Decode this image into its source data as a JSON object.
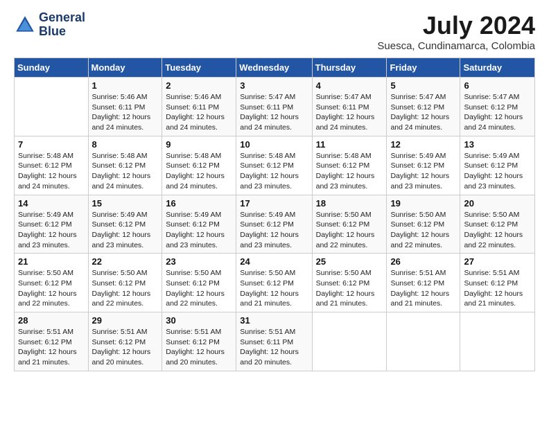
{
  "logo": {
    "line1": "General",
    "line2": "Blue"
  },
  "title": {
    "month_year": "July 2024",
    "location": "Suesca, Cundinamarca, Colombia"
  },
  "headers": [
    "Sunday",
    "Monday",
    "Tuesday",
    "Wednesday",
    "Thursday",
    "Friday",
    "Saturday"
  ],
  "weeks": [
    [
      {
        "num": "",
        "info": ""
      },
      {
        "num": "1",
        "info": "Sunrise: 5:46 AM\nSunset: 6:11 PM\nDaylight: 12 hours\nand 24 minutes."
      },
      {
        "num": "2",
        "info": "Sunrise: 5:46 AM\nSunset: 6:11 PM\nDaylight: 12 hours\nand 24 minutes."
      },
      {
        "num": "3",
        "info": "Sunrise: 5:47 AM\nSunset: 6:11 PM\nDaylight: 12 hours\nand 24 minutes."
      },
      {
        "num": "4",
        "info": "Sunrise: 5:47 AM\nSunset: 6:11 PM\nDaylight: 12 hours\nand 24 minutes."
      },
      {
        "num": "5",
        "info": "Sunrise: 5:47 AM\nSunset: 6:12 PM\nDaylight: 12 hours\nand 24 minutes."
      },
      {
        "num": "6",
        "info": "Sunrise: 5:47 AM\nSunset: 6:12 PM\nDaylight: 12 hours\nand 24 minutes."
      }
    ],
    [
      {
        "num": "7",
        "info": "Sunrise: 5:48 AM\nSunset: 6:12 PM\nDaylight: 12 hours\nand 24 minutes."
      },
      {
        "num": "8",
        "info": "Sunrise: 5:48 AM\nSunset: 6:12 PM\nDaylight: 12 hours\nand 24 minutes."
      },
      {
        "num": "9",
        "info": "Sunrise: 5:48 AM\nSunset: 6:12 PM\nDaylight: 12 hours\nand 24 minutes."
      },
      {
        "num": "10",
        "info": "Sunrise: 5:48 AM\nSunset: 6:12 PM\nDaylight: 12 hours\nand 23 minutes."
      },
      {
        "num": "11",
        "info": "Sunrise: 5:48 AM\nSunset: 6:12 PM\nDaylight: 12 hours\nand 23 minutes."
      },
      {
        "num": "12",
        "info": "Sunrise: 5:49 AM\nSunset: 6:12 PM\nDaylight: 12 hours\nand 23 minutes."
      },
      {
        "num": "13",
        "info": "Sunrise: 5:49 AM\nSunset: 6:12 PM\nDaylight: 12 hours\nand 23 minutes."
      }
    ],
    [
      {
        "num": "14",
        "info": "Sunrise: 5:49 AM\nSunset: 6:12 PM\nDaylight: 12 hours\nand 23 minutes."
      },
      {
        "num": "15",
        "info": "Sunrise: 5:49 AM\nSunset: 6:12 PM\nDaylight: 12 hours\nand 23 minutes."
      },
      {
        "num": "16",
        "info": "Sunrise: 5:49 AM\nSunset: 6:12 PM\nDaylight: 12 hours\nand 23 minutes."
      },
      {
        "num": "17",
        "info": "Sunrise: 5:49 AM\nSunset: 6:12 PM\nDaylight: 12 hours\nand 23 minutes."
      },
      {
        "num": "18",
        "info": "Sunrise: 5:50 AM\nSunset: 6:12 PM\nDaylight: 12 hours\nand 22 minutes."
      },
      {
        "num": "19",
        "info": "Sunrise: 5:50 AM\nSunset: 6:12 PM\nDaylight: 12 hours\nand 22 minutes."
      },
      {
        "num": "20",
        "info": "Sunrise: 5:50 AM\nSunset: 6:12 PM\nDaylight: 12 hours\nand 22 minutes."
      }
    ],
    [
      {
        "num": "21",
        "info": "Sunrise: 5:50 AM\nSunset: 6:12 PM\nDaylight: 12 hours\nand 22 minutes."
      },
      {
        "num": "22",
        "info": "Sunrise: 5:50 AM\nSunset: 6:12 PM\nDaylight: 12 hours\nand 22 minutes."
      },
      {
        "num": "23",
        "info": "Sunrise: 5:50 AM\nSunset: 6:12 PM\nDaylight: 12 hours\nand 22 minutes."
      },
      {
        "num": "24",
        "info": "Sunrise: 5:50 AM\nSunset: 6:12 PM\nDaylight: 12 hours\nand 21 minutes."
      },
      {
        "num": "25",
        "info": "Sunrise: 5:50 AM\nSunset: 6:12 PM\nDaylight: 12 hours\nand 21 minutes."
      },
      {
        "num": "26",
        "info": "Sunrise: 5:51 AM\nSunset: 6:12 PM\nDaylight: 12 hours\nand 21 minutes."
      },
      {
        "num": "27",
        "info": "Sunrise: 5:51 AM\nSunset: 6:12 PM\nDaylight: 12 hours\nand 21 minutes."
      }
    ],
    [
      {
        "num": "28",
        "info": "Sunrise: 5:51 AM\nSunset: 6:12 PM\nDaylight: 12 hours\nand 21 minutes."
      },
      {
        "num": "29",
        "info": "Sunrise: 5:51 AM\nSunset: 6:12 PM\nDaylight: 12 hours\nand 20 minutes."
      },
      {
        "num": "30",
        "info": "Sunrise: 5:51 AM\nSunset: 6:12 PM\nDaylight: 12 hours\nand 20 minutes."
      },
      {
        "num": "31",
        "info": "Sunrise: 5:51 AM\nSunset: 6:11 PM\nDaylight: 12 hours\nand 20 minutes."
      },
      {
        "num": "",
        "info": ""
      },
      {
        "num": "",
        "info": ""
      },
      {
        "num": "",
        "info": ""
      }
    ]
  ]
}
